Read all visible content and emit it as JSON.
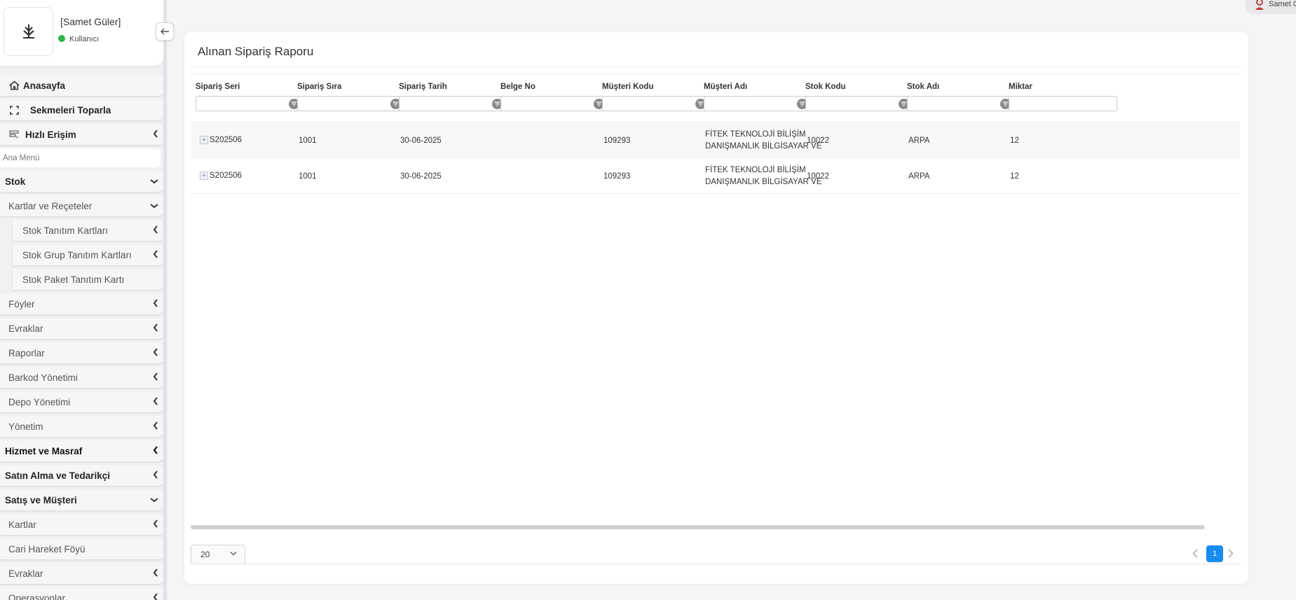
{
  "profile": {
    "name": "[Samet Güler]",
    "role": "Kullanıcı"
  },
  "sidebar": {
    "search_placeholder": "Ana Menü",
    "items_top": [
      {
        "label": "Anasayfa"
      },
      {
        "label": "Sekmeleri Toparla"
      },
      {
        "label": "Hızlı Erişim"
      }
    ],
    "items": [
      {
        "label": "Stok"
      },
      {
        "label": "Kartlar ve Reçeteler"
      },
      {
        "label": "Stok Tanıtım Kartları"
      },
      {
        "label": "Stok Grup Tanıtım Kartları"
      },
      {
        "label": "Stok Paket Tanıtım Kartı"
      },
      {
        "label": "Föyler"
      },
      {
        "label": "Evraklar"
      },
      {
        "label": "Raporlar"
      },
      {
        "label": "Barkod Yönetimi"
      },
      {
        "label": "Depo Yönetimi"
      },
      {
        "label": "Yönetim"
      },
      {
        "label": "Hizmet ve Masraf"
      },
      {
        "label": "Satın Alma ve Tedarikçi"
      },
      {
        "label": "Satış ve Müşteri"
      },
      {
        "label": "Kartlar"
      },
      {
        "label": "Cari Hareket Föyü"
      },
      {
        "label": "Evraklar"
      },
      {
        "label": "Operasyonlar"
      }
    ]
  },
  "topbar": {
    "user": "Samet G"
  },
  "report": {
    "title": "Alınan Sipariş Raporu",
    "columns": [
      "Sipariş Seri",
      "Sipariş Sıra",
      "Sipariş Tarih",
      "Belge No",
      "Müşteri Kodu",
      "Müşteri Adı",
      "Stok Kodu",
      "Stok Adı",
      "Miktar"
    ],
    "rows": [
      {
        "seri": "S202506",
        "sira": "1001",
        "tarih": "30-06-2025",
        "belge": "",
        "musteri_kodu": "109293",
        "musteri_adi_1": "FİTEK TEKNOLOJİ BİLİŞİM",
        "musteri_adi_2": "DANIŞMANLIK BİLGİSAYAR VE",
        "stok_kodu": "10022",
        "stok_adi": "ARPA",
        "miktar": "12"
      },
      {
        "seri": "S202506",
        "sira": "1001",
        "tarih": "30-06-2025",
        "belge": "",
        "musteri_kodu": "109293",
        "musteri_adi_1": "FİTEK TEKNOLOJİ BİLİŞİM",
        "musteri_adi_2": "DANIŞMANLIK BİLGİSAYAR VE",
        "stok_kodu": "10022",
        "stok_adi": "ARPA",
        "miktar": "12"
      }
    ]
  },
  "pager": {
    "page_size": "20",
    "current_page": "1"
  },
  "colors": {
    "accent": "#1a8cf0",
    "status_online": "#2bb34a"
  }
}
